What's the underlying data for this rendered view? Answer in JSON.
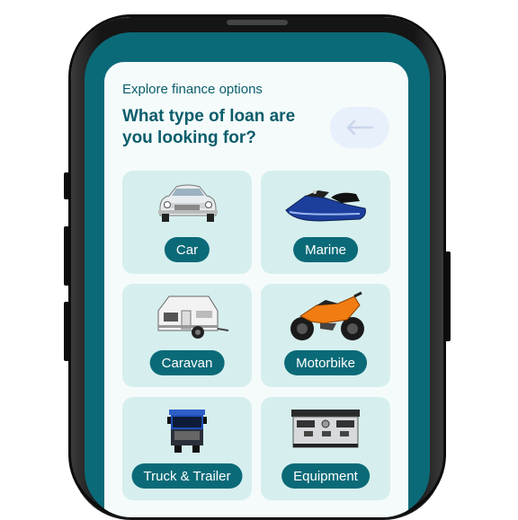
{
  "header": {
    "subtitle": "Explore finance options",
    "title": "What type of loan are you looking for?"
  },
  "colors": {
    "screen": "#0b6a78",
    "card": "#f5fbfb",
    "tile": "#d6efee",
    "pill": "#0b6a78",
    "text": "#0b5d6b"
  },
  "tiles": [
    {
      "label": "Car",
      "icon": "car-icon"
    },
    {
      "label": "Marine",
      "icon": "jet-ski-icon"
    },
    {
      "label": "Caravan",
      "icon": "caravan-icon"
    },
    {
      "label": "Motorbike",
      "icon": "motorbike-icon"
    },
    {
      "label": "Truck & Trailer",
      "icon": "truck-icon"
    },
    {
      "label": "Equipment",
      "icon": "espresso-machine-icon"
    }
  ]
}
